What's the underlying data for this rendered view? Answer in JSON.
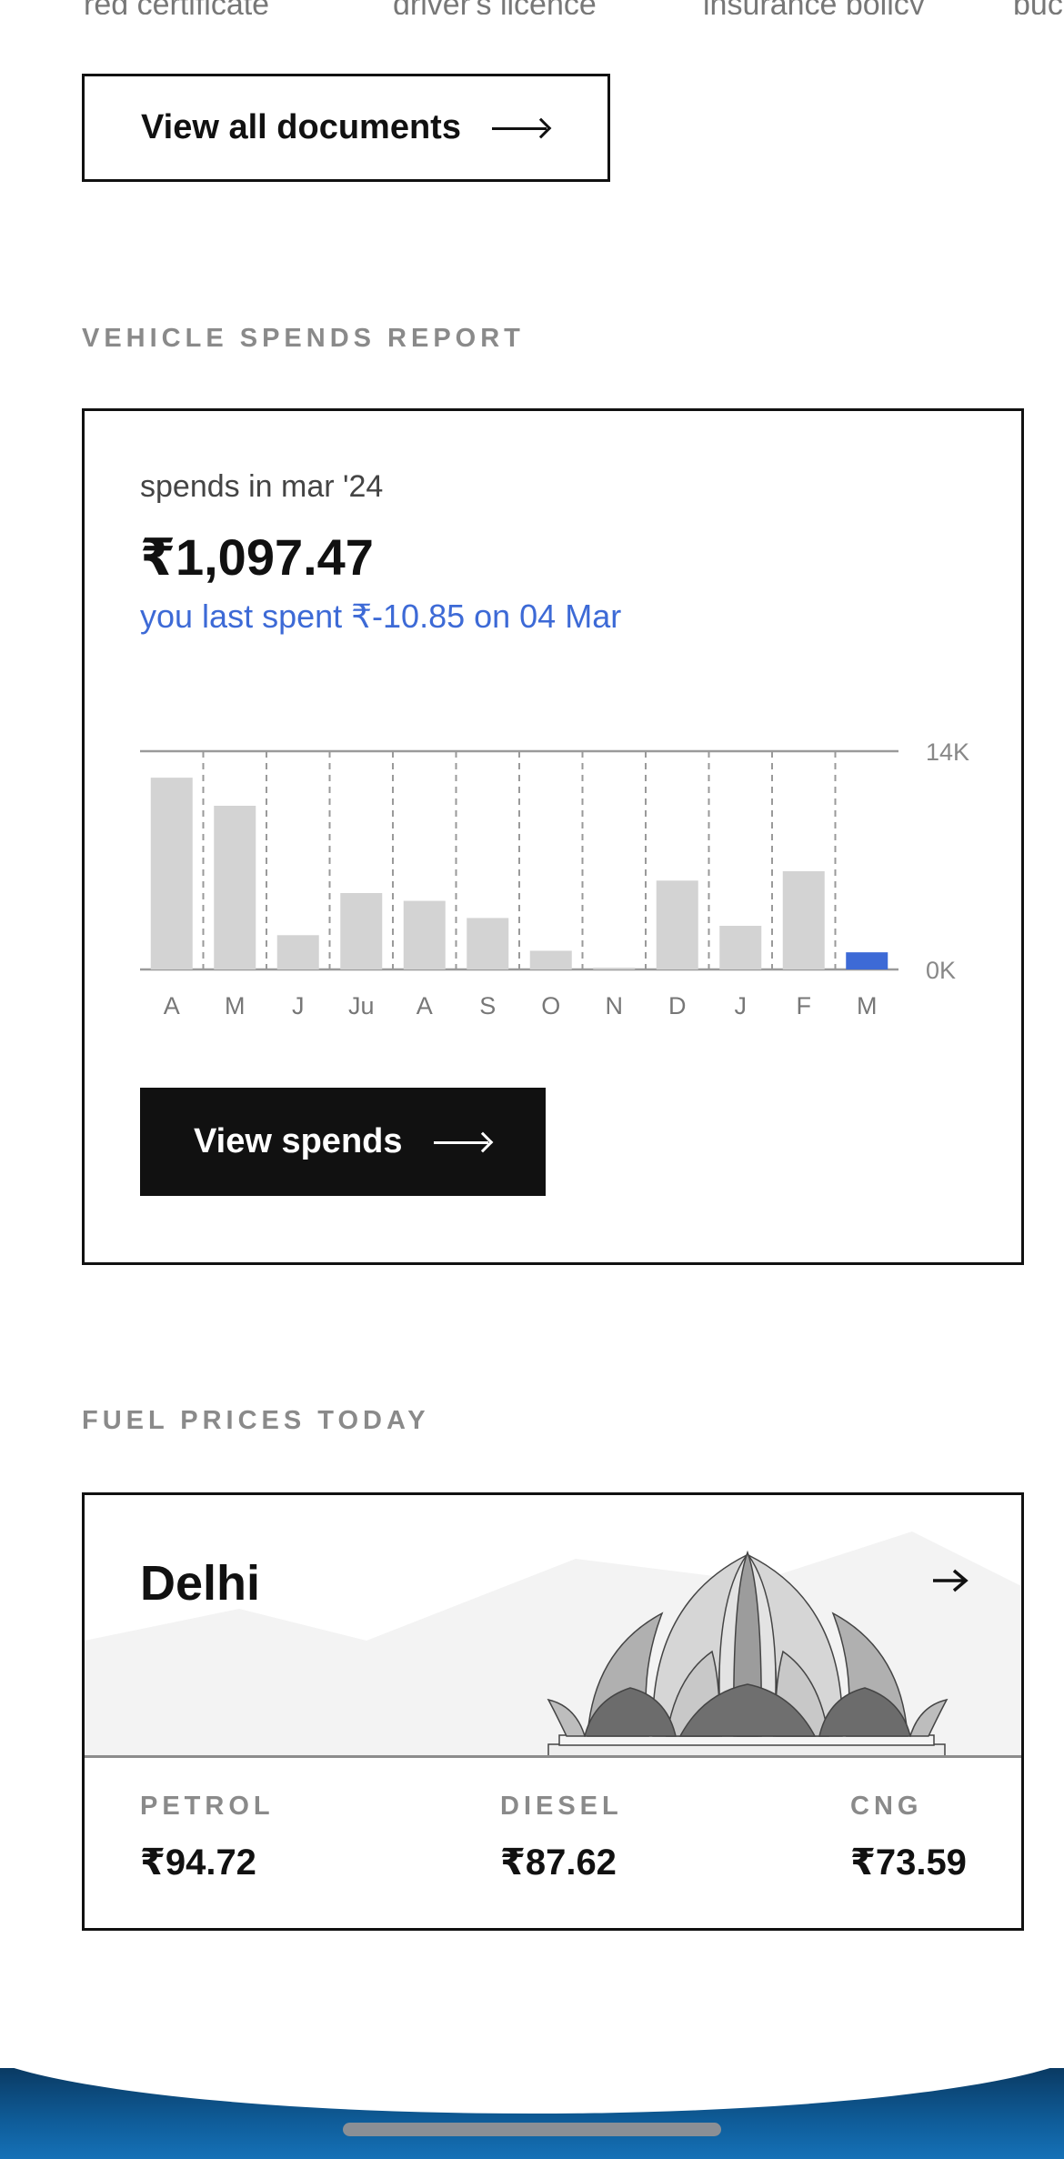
{
  "documents": {
    "tabs": [
      "reg certificate",
      "driver's licence",
      "insurance policy",
      "puc"
    ],
    "view_all_label": "View all documents"
  },
  "spends": {
    "section_title": "VEHICLE SPENDS REPORT",
    "period_label": "spends in mar '24",
    "amount": "₹1,097.47",
    "last_spent": "you last spent ₹-10.85 on 04 Mar",
    "button_label": "View spends",
    "accent_color": "#3d6ad6"
  },
  "chart_data": {
    "type": "bar",
    "categories": [
      "A",
      "M",
      "J",
      "Ju",
      "A",
      "S",
      "O",
      "N",
      "D",
      "J",
      "F",
      "M"
    ],
    "values": [
      12300,
      10500,
      2200,
      4900,
      4400,
      3300,
      1200,
      100,
      5700,
      2800,
      6300,
      1100
    ],
    "ylim": [
      0,
      14000
    ],
    "y_tick_labels": [
      "14K",
      "0K"
    ],
    "highlight_index": 11,
    "bar_color": "#d3d3d3",
    "highlight_color": "#3d6ad6",
    "grid": "dashed vertical"
  },
  "fuel": {
    "section_title": "FUEL PRICES TODAY",
    "city": "Delhi",
    "prices": [
      {
        "name": "PETROL",
        "price": "₹94.72"
      },
      {
        "name": "DIESEL",
        "price": "₹87.62"
      },
      {
        "name": "CNG",
        "price": "₹73.59"
      }
    ]
  },
  "icons": [
    "arrow-right-icon",
    "lotus-temple-illustration"
  ]
}
